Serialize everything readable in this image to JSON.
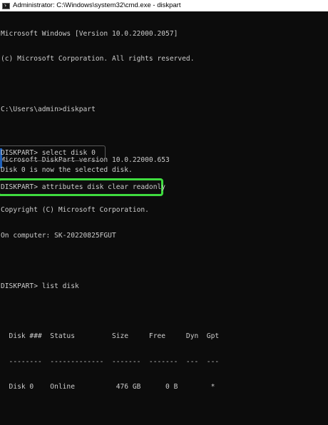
{
  "window": {
    "title": "Administrator: C:\\Windows\\system32\\cmd.exe - diskpart",
    "icon": "cmd-icon"
  },
  "console": {
    "lines": [
      "Microsoft Windows [Version 10.0.22000.2057]",
      "(c) Microsoft Corporation. All rights reserved.",
      "",
      "C:\\Users\\admin>diskpart",
      "",
      "Microsoft DiskPart version 10.0.22000.653",
      "",
      "Copyright (C) Microsoft Corporation.",
      "On computer: SK-20220825FGUT",
      "",
      "DISKPART> list disk",
      "",
      "  Disk ###  Status         Size     Free     Dyn  Gpt",
      "  --------  -------------  -------  -------  ---  ---",
      "  Disk 0    Online          476 GB      0 B        *",
      ""
    ],
    "select_command": "DISKPART> select disk 0",
    "select_result": "Disk 0 is now the selected disk.",
    "attributes_command": "DISKPART> attributes disk clear readonly",
    "highlight_color": "#3fdc3f"
  }
}
